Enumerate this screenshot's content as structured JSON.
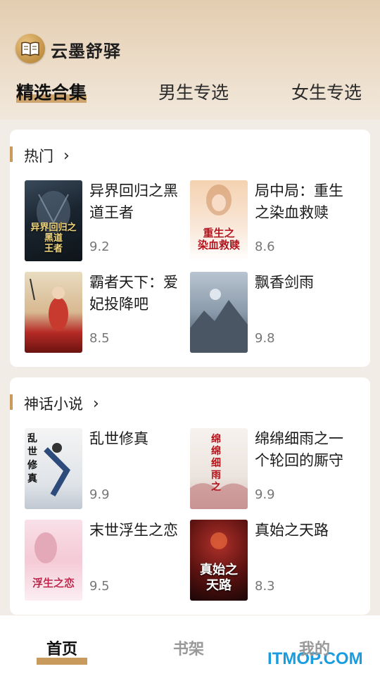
{
  "app": {
    "title": "云墨舒驿",
    "logo_icon": "open-book-icon"
  },
  "tabs": [
    {
      "label": "精选合集",
      "active": true
    },
    {
      "label": "男生专选",
      "active": false
    },
    {
      "label": "女生专选",
      "active": false
    }
  ],
  "sections": [
    {
      "title": "热门",
      "books": [
        {
          "title": "异界回归之黑道王者",
          "score": "9.2",
          "cover_text": "异界回归之\n黑道\n王者"
        },
        {
          "title": "局中局：重生之染血救赎",
          "score": "8.6",
          "cover_text": "重生之\n染血救赎"
        },
        {
          "title": "霸者天下：爱妃投降吧",
          "score": "8.5",
          "cover_text": ""
        },
        {
          "title": "飘香剑雨",
          "score": "9.8",
          "cover_text": ""
        }
      ]
    },
    {
      "title": "神话小说",
      "books": [
        {
          "title": "乱世修真",
          "score": "9.9",
          "cover_text": "乱世修真"
        },
        {
          "title": "绵绵细雨之一个轮回的厮守",
          "score": "9.9",
          "cover_text": "绵绵细雨之"
        },
        {
          "title": "末世浮生之恋",
          "score": "9.5",
          "cover_text": "浮生之恋"
        },
        {
          "title": "真始之天路",
          "score": "8.3",
          "cover_text": "真始之\n天路"
        }
      ]
    }
  ],
  "bottom_nav": [
    {
      "label": "首页",
      "active": true
    },
    {
      "label": "书架",
      "active": false
    },
    {
      "label": "我的",
      "active": false
    }
  ],
  "watermark": "ITMOP.COM",
  "colors": {
    "accent": "#c89a5c",
    "header_top": "#e3cdb0",
    "background": "#f1ece6"
  }
}
